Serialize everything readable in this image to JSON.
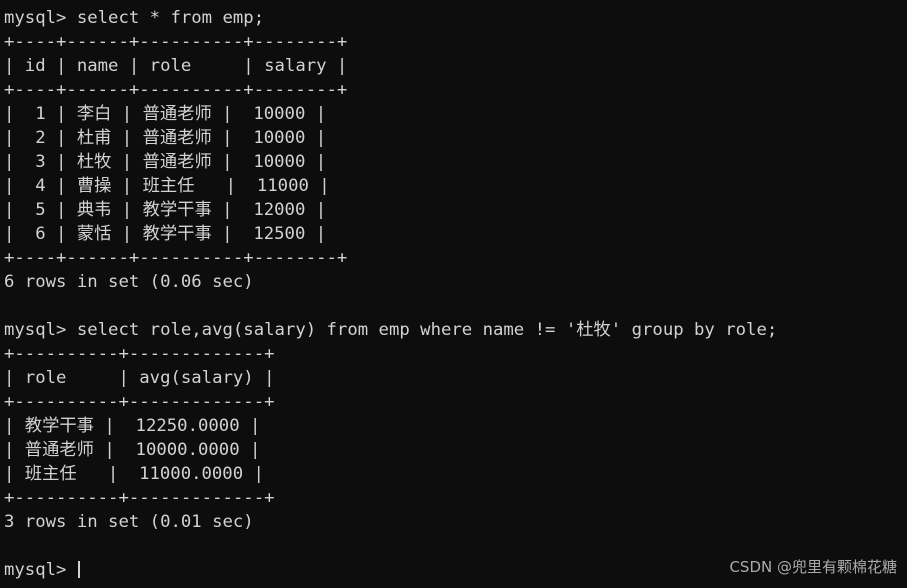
{
  "terminal": {
    "background_color": "#0d0d0d",
    "text_color": "#d2d2d2",
    "prompt": "mysql> ",
    "lines": [
      "mysql> select * from emp;",
      "+----+------+----------+--------+",
      "| id | name | role     | salary |",
      "+----+------+----------+--------+",
      "|  1 | 李白 | 普通老师 |  10000 |",
      "|  2 | 杜甫 | 普通老师 |  10000 |",
      "|  3 | 杜牧 | 普通老师 |  10000 |",
      "|  4 | 曹操 | 班主任   |  11000 |",
      "|  5 | 典韦 | 教学干事 |  12000 |",
      "|  6 | 蒙恬 | 教学干事 |  12500 |",
      "+----+------+----------+--------+",
      "6 rows in set (0.06 sec)",
      "",
      "mysql> select role,avg(salary) from emp where name != '杜牧' group by role;",
      "+----------+-------------+",
      "| role     | avg(salary) |",
      "+----------+-------------+",
      "| 教学干事 |  12250.0000 |",
      "| 普通老师 |  10000.0000 |",
      "| 班主任   |  11000.0000 |",
      "+----------+-------------+",
      "3 rows in set (0.01 sec)",
      ""
    ],
    "final_prompt": "mysql> "
  },
  "queries": [
    {
      "sql": "select * from emp;",
      "status": "6 rows in set (0.06 sec)",
      "row_count": 6,
      "duration_sec": "0.06",
      "columns": [
        "id",
        "name",
        "role",
        "salary"
      ],
      "rows": [
        [
          "1",
          "李白",
          "普通老师",
          "10000"
        ],
        [
          "2",
          "杜甫",
          "普通老师",
          "10000"
        ],
        [
          "3",
          "杜牧",
          "普通老师",
          "10000"
        ],
        [
          "4",
          "曹操",
          "班主任",
          "11000"
        ],
        [
          "5",
          "典韦",
          "教学干事",
          "12000"
        ],
        [
          "6",
          "蒙恬",
          "教学干事",
          "12500"
        ]
      ]
    },
    {
      "sql": "select role,avg(salary) from emp where name != '杜牧' group by role;",
      "status": "3 rows in set (0.01 sec)",
      "row_count": 3,
      "duration_sec": "0.01",
      "columns": [
        "role",
        "avg(salary)"
      ],
      "rows": [
        [
          "教学干事",
          "12250.0000"
        ],
        [
          "普通老师",
          "10000.0000"
        ],
        [
          "班主任",
          "11000.0000"
        ]
      ]
    }
  ],
  "watermark": {
    "text": "CSDN @兜里有颗棉花糖"
  }
}
